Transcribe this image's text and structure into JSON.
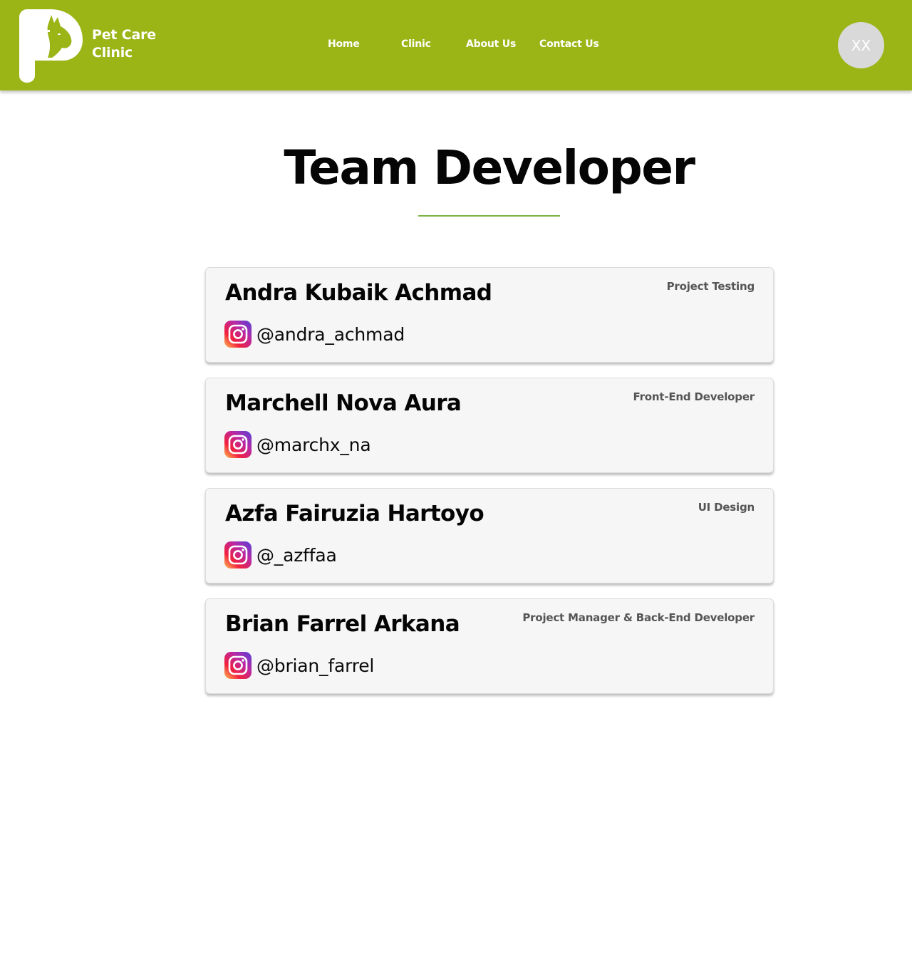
{
  "header": {
    "brand": {
      "line1": "Pet Care",
      "line2": "Clinic"
    },
    "nav": [
      {
        "label": "Home"
      },
      {
        "label": "Clinic"
      },
      {
        "label": "About Us"
      },
      {
        "label": "Contact Us"
      }
    ],
    "avatar_initials": "XX",
    "colors": {
      "bar": "#9cb516",
      "text": "#ffffff",
      "avatar_bg": "#d9d9d9"
    }
  },
  "main": {
    "title": "Team Developer",
    "accent_rule_color": "#7cb342",
    "members": [
      {
        "name": "Andra Kubaik Achmad",
        "role": "Project Testing",
        "instagram": "@andra_achmad",
        "icon": "instagram-icon"
      },
      {
        "name": "Marchell Nova Aura",
        "role": "Front-End Developer",
        "instagram": "@marchx_na",
        "icon": "instagram-icon"
      },
      {
        "name": "Azfa Fairuzia Hartoyo",
        "role": "UI Design",
        "instagram": "@_azffaa",
        "icon": "instagram-icon"
      },
      {
        "name": "Brian Farrel Arkana",
        "role": "Project Manager & Back-End Developer",
        "instagram": "@brian_farrel",
        "icon": "instagram-icon"
      }
    ]
  }
}
